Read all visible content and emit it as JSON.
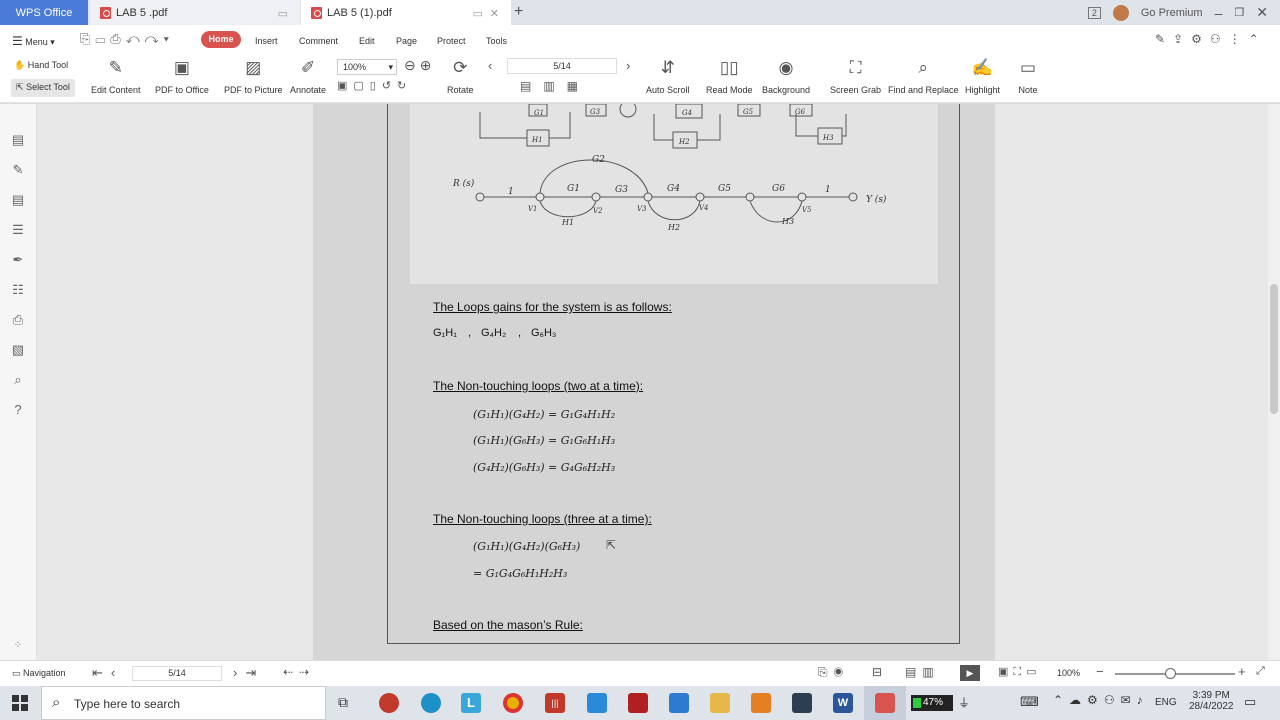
{
  "tabs": {
    "wps": "WPS Office",
    "lab5": "LAB 5 .pdf",
    "lab5b": "LAB 5  (1).pdf",
    "new": "+"
  },
  "titlebar": {
    "badge": "2",
    "go_premium": "Go Premium"
  },
  "menu": {
    "menu_label": "Menu",
    "tabs": [
      "Home",
      "Insert",
      "Comment",
      "Edit",
      "Page",
      "Protect",
      "Tools"
    ]
  },
  "toolbar": {
    "hand_tool": "Hand Tool",
    "select_tool": "Select Tool",
    "edit_content": "Edit Content",
    "pdf_to_office": "PDF to Office",
    "pdf_to_picture": "PDF to Picture",
    "annotate": "Annotate",
    "zoom": "100%",
    "page": "5/14",
    "rotate": "Rotate",
    "auto_scroll": "Auto Scroll",
    "read_mode": "Read Mode",
    "background": "Background",
    "screen_grab": "Screen Grab",
    "find_replace": "Find and Replace",
    "highlight": "Highlight",
    "note": "Note"
  },
  "figure": {
    "rs": "R (s)",
    "ys": "Y (s)",
    "g_labels": [
      "G1",
      "G2",
      "G3",
      "G4",
      "G5",
      "G6",
      "G1",
      "G3",
      "G4",
      "G5",
      "G6"
    ],
    "h_labels": [
      "H1",
      "H2",
      "H3",
      "H1",
      "H2",
      "H3"
    ],
    "v_labels": [
      "V1",
      "V2",
      "V3",
      "V4",
      "V5"
    ],
    "unity": [
      "1",
      "1"
    ]
  },
  "doc": {
    "loops_heading": "The Loops gains for the system is as follows:",
    "loops": [
      "G₁H₁",
      ",",
      "G₄H₂",
      ",",
      "G₆H₃"
    ],
    "two_heading": "The Non-touching loops (two at a time):",
    "two_eqs": [
      "(G₁H₁)(G₄H₂) = G₁G₄H₁H₂",
      "(G₁H₁)(G₆H₃) = G₁G₆H₁H₃",
      "(G₄H₂)(G₆H₃) = G₄G₆H₂H₃"
    ],
    "three_heading": "The Non-touching loops (three at a time):",
    "three_eqs": [
      "(G₁H₁)(G₄H₂)(G₆H₃)",
      "= G₁G₄G₆H₁H₂H₃"
    ],
    "mason_heading": "Based on the mason’s Rule:"
  },
  "status": {
    "navigation": "Navigation",
    "page": "5/14",
    "zoom": "100%"
  },
  "taskbar": {
    "search_placeholder": "Type here to search",
    "battery": "47%",
    "lang": "ENG",
    "time": "3:39 PM",
    "date": "28/4/2022"
  },
  "colors": {
    "accent": "#d9534f",
    "wps_blue": "#4b7bd8"
  }
}
